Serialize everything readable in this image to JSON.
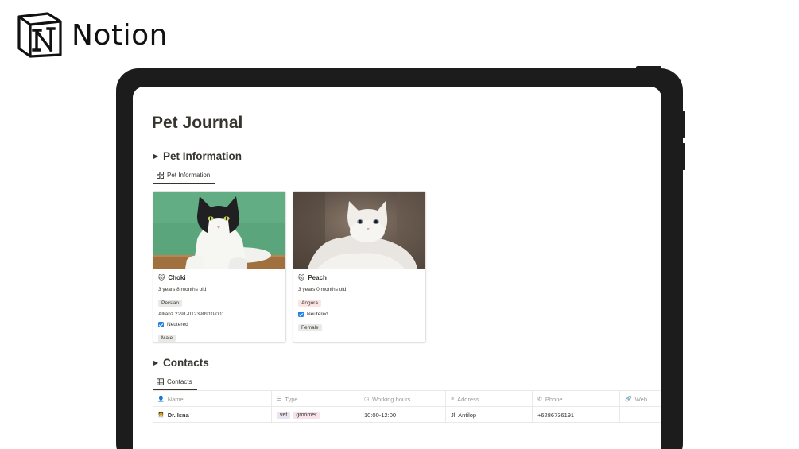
{
  "brand": {
    "name": "Notion",
    "logo_icon": "notion-logo"
  },
  "page": {
    "title": "Pet Journal",
    "sections": {
      "pet_information": {
        "title": "Pet Information",
        "view_tab": "Pet Information",
        "view_icon": "gallery-grid-icon",
        "cards": [
          {
            "name": "Choki",
            "icon": "cat-face",
            "age": "3 years 8 months old",
            "breed": "Persian",
            "breed_color": "#e9e9e7",
            "insurance": "Allianz 2291-012390910-001",
            "neutered_label": "Neutered",
            "neutered": true,
            "sex": "Male",
            "photo": "black-and-white cat on green background"
          },
          {
            "name": "Peach",
            "icon": "cat-face",
            "age": "3 years 0 months old",
            "breed": "Angora",
            "breed_color": "#fbe4e4",
            "neutered_label": "Neutered",
            "neutered": true,
            "sex": "Female",
            "photo": "white long-haired cat"
          }
        ]
      },
      "contacts": {
        "title": "Contacts",
        "view_tab": "Contacts",
        "view_icon": "table-icon",
        "columns": [
          {
            "label": "Name",
            "icon": "person-icon"
          },
          {
            "label": "Type",
            "icon": "list-icon"
          },
          {
            "label": "Working hours",
            "icon": "clock-icon"
          },
          {
            "label": "Address",
            "icon": "text-icon"
          },
          {
            "label": "Phone",
            "icon": "phone-icon"
          },
          {
            "label": "Web",
            "icon": "link-icon"
          }
        ],
        "rows": [
          {
            "name": "Dr. Isna",
            "type_tags": [
              "vet",
              "groomer"
            ],
            "working_hours": "10:00-12:00",
            "address": "Jl. Antilop",
            "phone": "+6286736191",
            "web": ""
          }
        ]
      }
    }
  },
  "colors": {
    "accent_checkbox": "#2383e2",
    "text": "#37352f",
    "muted": "#9b9a97",
    "device": "#1c1c1c"
  }
}
